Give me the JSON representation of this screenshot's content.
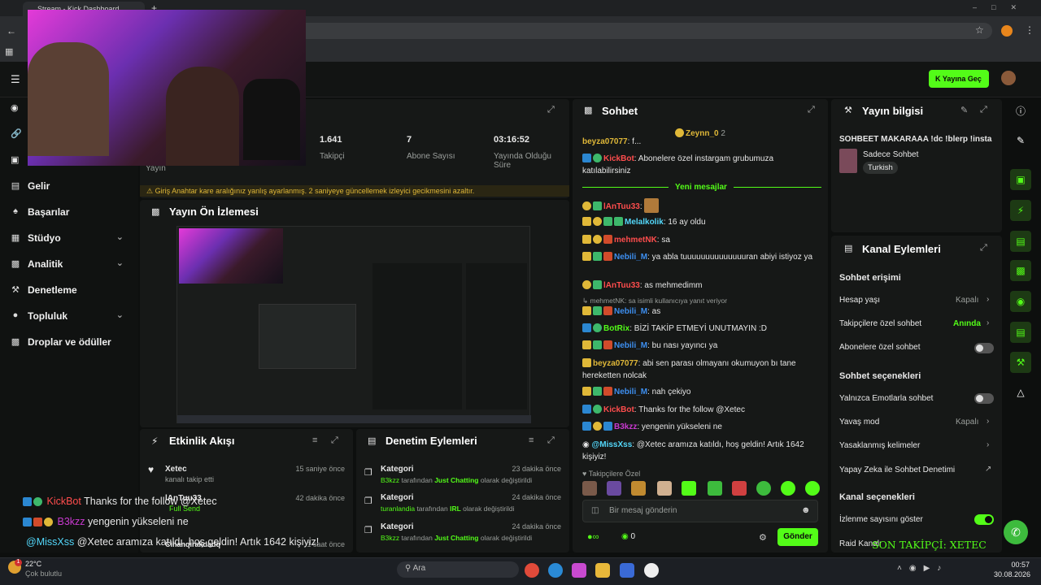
{
  "browser": {
    "tab_title": "Stream - Kick Dashboard",
    "new_tab": "+"
  },
  "topbar": {
    "go_live": "Yayına Geç"
  },
  "sidebar": {
    "items": [
      {
        "label": "Gelir"
      },
      {
        "label": "Başarılar"
      },
      {
        "label": "Stüdyo",
        "chevron": true
      },
      {
        "label": "Analitik",
        "chevron": true
      },
      {
        "label": "Denetleme"
      },
      {
        "label": "Topluluk",
        "chevron": true
      },
      {
        "label": "Droplar ve ödüller"
      }
    ]
  },
  "stats": {
    "viewers_label": "Yayın",
    "followers_value": "1.641",
    "followers_label": "Takipçi",
    "subs_value": "7",
    "subs_label": "Abone Sayısı",
    "uptime_value": "03:16:52",
    "uptime_label": "Yayında Olduğu Süre",
    "warning": "Giriş Anahtar kare aralığınız yanlış ayarlanmış. 2 saniyeye güncellemek izleyici gecikmesini azaltır."
  },
  "preview": {
    "title": "Yayın Ön İzlemesi"
  },
  "activity": {
    "title": "Etkinlik Akışı",
    "items": [
      {
        "name": "Xetec",
        "desc": "kanalı takip etti",
        "time": "15 saniye önce"
      },
      {
        "name": "lAnTuu33",
        "desc": "Full Send",
        "time": "42 dakika önce"
      },
      {
        "name": "Cihanqirakdadq",
        "desc": "",
        "time": "1 saat önce"
      }
    ]
  },
  "moderation": {
    "title": "Denetim Eylemleri",
    "items": [
      {
        "title": "Kategori",
        "user": "B3kzz",
        "mid": "tarafından",
        "cat": "Just Chatting",
        "tail": "olarak değiştirildi",
        "time": "23 dakika önce"
      },
      {
        "title": "Kategori",
        "user": "turanlandia",
        "mid": "tarafından",
        "cat": "IRL",
        "tail": "olarak değiştirildi",
        "time": "24 dakika önce"
      },
      {
        "title": "Kategori",
        "user": "B3kzz",
        "mid": "tarafından",
        "cat": "Just Chatting",
        "tail": "olarak değiştirildi",
        "time": "24 dakika önce"
      }
    ]
  },
  "chat": {
    "title": "Sohbet",
    "pinned_user": "Zeynn_0",
    "pinned_count": "2",
    "new_messages": "Yeni mesajlar",
    "reply_hint": "mehmetNK: sa isimli kullanıcıya yanıt veriyor",
    "followers_only_label": "Takipçilere Özel",
    "input_placeholder": "Bir mesaj gönderin",
    "send": "Gönder",
    "count": "0",
    "messages": [
      {
        "user": "beyza07077",
        "text": ": f...",
        "color": "#e0b838"
      },
      {
        "user": "KickBot",
        "text": ": Abonelere özel instargam grubumuza katılabilirsiniz",
        "color": "#ff4d4d"
      },
      {
        "user": "lAnTuu33",
        "text": ":",
        "color": "#ff4d4d"
      },
      {
        "user": "Melalkolik",
        "text": ": 16 ay oldu",
        "color": "#53d8fb"
      },
      {
        "user": "mehmetNK",
        "text": ": sa",
        "color": "#ff4d4d"
      },
      {
        "user": "Nebili_M",
        "text": ": ya abla tuuuuuuuuuuuuuuran abiyi istiyoz ya",
        "color": "#3d8ff0"
      },
      {
        "user": "lAnTuu33",
        "text": ": as mehmedimm",
        "color": "#ff4d4d"
      },
      {
        "user": "Nebili_M",
        "text": ": as",
        "color": "#3d8ff0"
      },
      {
        "user": "BotRix",
        "text": ": BİZİ TAKİP ETMEYİ UNUTMAYIN :D",
        "color": "#53fc18"
      },
      {
        "user": "Nebili_M",
        "text": ": bu nası yayıncı ya",
        "color": "#3d8ff0"
      },
      {
        "user": "beyza07077",
        "text": ": abi sen parası olmayanı okumuyon bı tane hereketten nolcak",
        "color": "#e0b838"
      },
      {
        "user": "Nebili_M",
        "text": ": nah çekiyo",
        "color": "#3d8ff0"
      },
      {
        "user": "KickBot",
        "text": ": Thanks for the follow @Xetec",
        "color": "#ff4d4d"
      },
      {
        "user": "B3kzz",
        "text": ": yengenin yükseleni ne",
        "color": "#c93ad0"
      },
      {
        "user": "@MissXss",
        "text": ": @Xetec aramıza katıldı, hoş geldin! Artık 1642 kişiyiz!",
        "color": "#53d8fb"
      }
    ]
  },
  "stream_info": {
    "title": "Yayın bilgisi",
    "stream_title": "SOHBEET MAKARAAA !dc !blerp !insta",
    "category": "Sadece Sohbet",
    "tag": "Turkish"
  },
  "channel_actions": {
    "title": "Kanal Eylemleri",
    "chat_access": "Sohbet erişimi",
    "account_age": "Hesap yaşı",
    "account_age_value": "Kapalı",
    "followers_chat": "Takipçilere özel sohbet",
    "followers_chat_value": "Anında",
    "subs_chat": "Abonelere özel sohbet",
    "chat_options": "Sohbet seçenekleri",
    "emote_only": "Yalnızca Emotlarla sohbet",
    "slow_mode": "Yavaş mod",
    "slow_mode_value": "Kapalı",
    "banned_words": "Yasaklanmış kelimeler",
    "ai_moderation": "Yapay Zeka ile Sohbet Denetimi",
    "channel_options": "Kanal seçenekleri",
    "show_viewers": "İzlenme sayısını göster",
    "raid": "Raid Kanalı"
  },
  "overlay": {
    "line1_user": "KickBot",
    "line1_text": "Thanks for the follow @Xetec",
    "line2_user": "B3kzz",
    "line2_text": "yengenin yükseleni ne",
    "line3_user": "@MissXss",
    "line3_text": "@Xetec aramıza katıldı, hoş geldin! Artık 1642 kişiyiz!",
    "follower_banner": "SON TAKİPÇİ: XETEC"
  },
  "taskbar": {
    "temp": "22°C",
    "weather": "Çok bulutlu",
    "search": "Ara",
    "time": "00:57",
    "date": "30.08.2026",
    "weather_badge": "1"
  },
  "colors": {
    "accent": "#53fc18",
    "bg": "#0d0f0e",
    "panel": "#161817"
  }
}
